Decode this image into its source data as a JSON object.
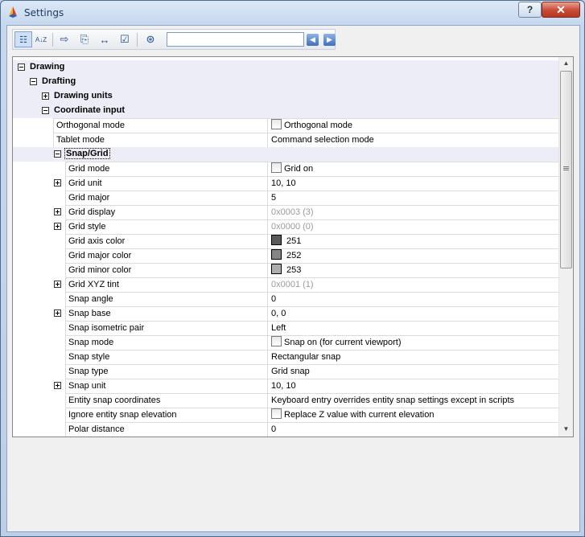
{
  "window": {
    "title": "Settings",
    "help_label": "?",
    "close_label": "✕",
    "accent": "#1f4f8f"
  },
  "toolbar": {
    "search_value": "",
    "buttons": [
      {
        "name": "categorized-view-icon",
        "glyph": "☷"
      },
      {
        "name": "alphabetical-sort-icon",
        "glyph": "A↓Z"
      },
      {
        "name": "export-icon",
        "glyph": "⇨"
      },
      {
        "name": "import-icon",
        "glyph": "⎘"
      },
      {
        "name": "dimension-icon",
        "glyph": "↔"
      },
      {
        "name": "checklist-icon",
        "glyph": "☑"
      },
      {
        "name": "binoculars-icon",
        "glyph": "⊛"
      }
    ],
    "prev_glyph": "◀",
    "next_glyph": "▶"
  },
  "tree": {
    "drawing": "Drawing",
    "drafting": "Drafting",
    "drawing_units": "Drawing units",
    "coordinate_input": "Coordinate input",
    "snap_grid": "Snap/Grid"
  },
  "coordinate_props": [
    {
      "name": "Orthogonal mode",
      "value": "Orthogonal mode",
      "checkbox": true
    },
    {
      "name": "Tablet mode",
      "value": "Command selection mode"
    }
  ],
  "snap_props": [
    {
      "name": "Grid mode",
      "value": "Grid on",
      "checkbox": true
    },
    {
      "name": "Grid unit",
      "value": "10, 10",
      "expandable": true
    },
    {
      "name": "Grid major",
      "value": "5"
    },
    {
      "name": "Grid display",
      "value": "0x0003 (3)",
      "expandable": true,
      "gray": true
    },
    {
      "name": "Grid style",
      "value": "0x0000 (0)",
      "expandable": true,
      "gray": true
    },
    {
      "name": "Grid axis color",
      "value": "251",
      "swatch": "#5a5a5a"
    },
    {
      "name": "Grid major color",
      "value": "252",
      "swatch": "#858585"
    },
    {
      "name": "Grid minor color",
      "value": "253",
      "swatch": "#aeaeae"
    },
    {
      "name": "Grid XYZ tint",
      "value": "0x0001 (1)",
      "expandable": true,
      "gray": true
    },
    {
      "name": "Snap angle",
      "value": "0"
    },
    {
      "name": "Snap base",
      "value": "0, 0",
      "expandable": true
    },
    {
      "name": "Snap isometric pair",
      "value": "Left"
    },
    {
      "name": "Snap mode",
      "value": "Snap on (for current viewport)",
      "checkbox": true
    },
    {
      "name": "Snap style",
      "value": "Rectangular snap"
    },
    {
      "name": "Snap type",
      "value": "Grid snap"
    },
    {
      "name": "Snap unit",
      "value": "10, 10",
      "expandable": true
    },
    {
      "name": "Entity snap coordinates",
      "value": "Keyboard entry overrides entity snap settings except in scripts"
    },
    {
      "name": "Ignore entity snap elevation",
      "value": "Replace Z value with current elevation",
      "checkbox": true
    },
    {
      "name": "Polar distance",
      "value": "0"
    }
  ],
  "scrollbar": {
    "up_glyph": "▲",
    "down_glyph": "▼"
  }
}
